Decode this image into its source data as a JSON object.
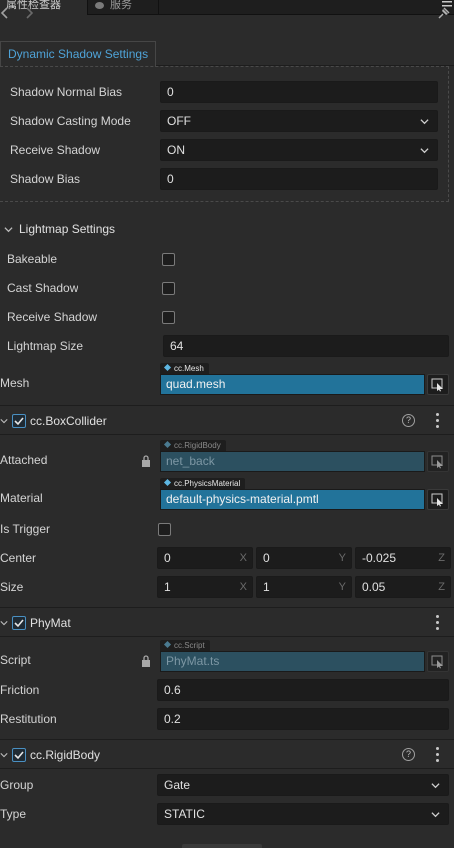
{
  "tabs": {
    "inspector": "属性检查器",
    "service": "服务"
  },
  "dynamic_shadow": {
    "tab_label": "Dynamic Shadow Settings",
    "normal_bias_label": "Shadow Normal Bias",
    "normal_bias_value": "0",
    "casting_mode_label": "Shadow Casting Mode",
    "casting_mode_value": "OFF",
    "receive_label": "Receive Shadow",
    "receive_value": "ON",
    "bias_label": "Shadow Bias",
    "bias_value": "0"
  },
  "lightmap": {
    "title": "Lightmap Settings",
    "bakeable_label": "Bakeable",
    "cast_shadow_label": "Cast Shadow",
    "receive_shadow_label": "Receive Shadow",
    "size_label": "Lightmap Size",
    "size_value": "64"
  },
  "mesh": {
    "label": "Mesh",
    "type_tag": "cc.Mesh",
    "value": "quad.mesh"
  },
  "box_collider": {
    "title": "cc.BoxCollider",
    "attached_label": "Attached",
    "attached_tag": "cc.RigidBody",
    "attached_value": "net_back",
    "material_label": "Material",
    "material_tag": "cc.PhysicsMaterial",
    "material_value": "default-physics-material.pmtl",
    "is_trigger_label": "Is Trigger",
    "center_label": "Center",
    "center_x": "0",
    "center_y": "0",
    "center_z": "-0.025",
    "size_label": "Size",
    "size_x": "1",
    "size_y": "1",
    "size_z": "0.05",
    "axis_x": "X",
    "axis_y": "Y",
    "axis_z": "Z"
  },
  "phymat": {
    "title": "PhyMat",
    "script_label": "Script",
    "script_tag": "cc.Script",
    "script_value": "PhyMat.ts",
    "friction_label": "Friction",
    "friction_value": "0.6",
    "restitution_label": "Restitution",
    "restitution_value": "0.2"
  },
  "rigidbody": {
    "title": "cc.RigidBody",
    "group_label": "Group",
    "group_value": "Gate",
    "type_label": "Type",
    "type_value": "STATIC"
  },
  "help_glyph": "?",
  "icons": [
    "back-arrow-icon",
    "forward-arrow-icon",
    "pin-icon",
    "menu-icon",
    "chevron-down-icon",
    "triangle-down-icon",
    "check-icon",
    "lock-icon",
    "pick-target-icon",
    "help-icon",
    "more-vertical-icon"
  ],
  "colors": {
    "accent": "#4fa3d8",
    "asset_field": "#22739a",
    "background": "#2b2b2b",
    "input": "#1c1c1c"
  }
}
